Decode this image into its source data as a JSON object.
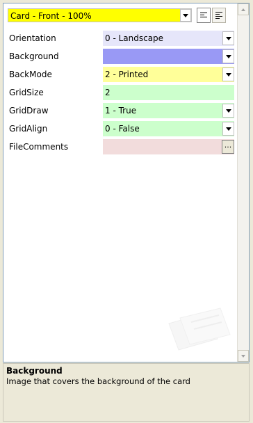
{
  "header": {
    "selector_value": "Card - Front - 100%",
    "selector_bg": "#ffff00",
    "toolbar": [
      {
        "icon": "align-left-icon",
        "pressed": true
      },
      {
        "icon": "align-justify-icon",
        "pressed": false
      }
    ]
  },
  "properties": [
    {
      "name": "Orientation",
      "value": "0 - Landscape",
      "color": "#e6e6fa",
      "control": "dropdown"
    },
    {
      "name": "Background",
      "value": "",
      "color": "#9999f5",
      "control": "dropdown"
    },
    {
      "name": "BackMode",
      "value": "2 - Printed",
      "color": "#ffff99",
      "control": "dropdown"
    },
    {
      "name": "GridSize",
      "value": "2",
      "color": "#ccffcc",
      "control": "text"
    },
    {
      "name": "GridDraw",
      "value": "1 - True",
      "color": "#ccffcc",
      "control": "dropdown"
    },
    {
      "name": "GridAlign",
      "value": "0 - False",
      "color": "#ccffcc",
      "control": "dropdown"
    },
    {
      "name": "FileComments",
      "value": "",
      "color": "#f2dcdc",
      "control": "ellipsis",
      "button_label": "..."
    }
  ],
  "description": {
    "title": "Background",
    "text": "Image that covers the background of the card"
  }
}
